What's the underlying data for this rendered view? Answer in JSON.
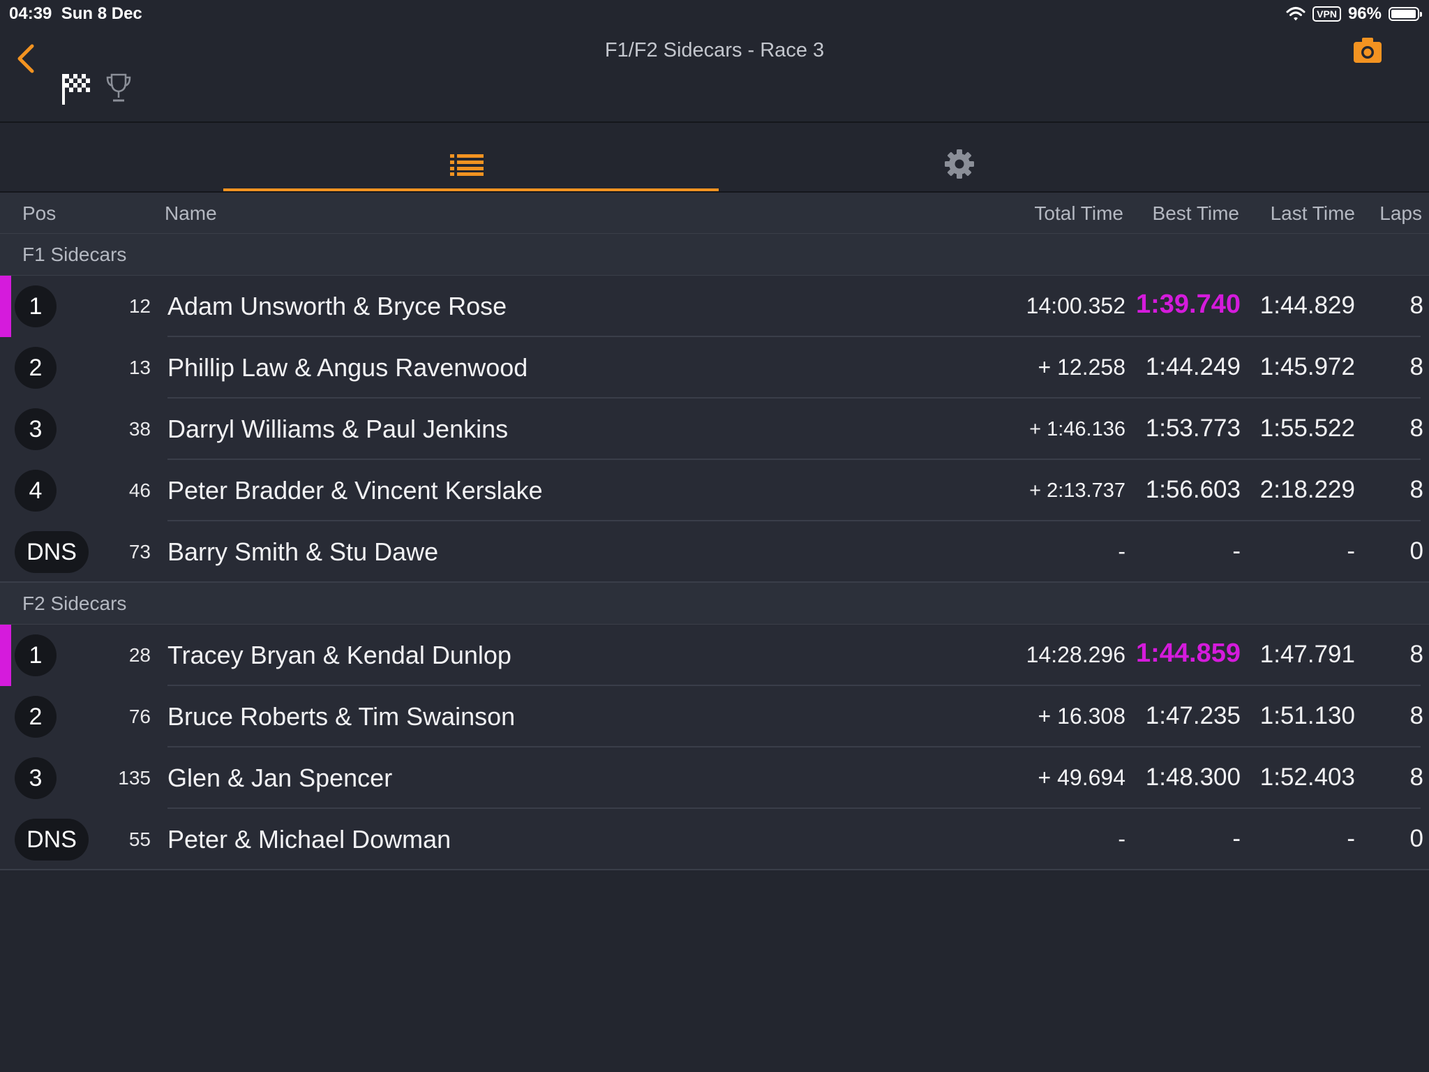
{
  "status": {
    "time": "04:39",
    "date": "Sun 8 Dec",
    "vpn": "VPN",
    "battery": "96%",
    "battery_level": 0.96
  },
  "header": {
    "title": "F1/F2 Sidecars - Race 3"
  },
  "icons": {
    "back": "chevron-left-icon",
    "camera": "camera-icon",
    "flag": "checkered-flag-icon",
    "trophy": "trophy-icon",
    "list": "list-icon",
    "settings": "gear-icon"
  },
  "colors": {
    "accent": "#f39321",
    "fastest": "#d51bdc",
    "background": "#23262f"
  },
  "columns": {
    "pos": "Pos",
    "name": "Name",
    "total": "Total Time",
    "best": "Best Time",
    "last": "Last Time",
    "laps": "Laps"
  },
  "groups": [
    {
      "name": "F1 Sidecars"
    },
    {
      "name": "F2 Sidecars"
    }
  ],
  "rows": [
    {
      "pos": "1",
      "num": "12",
      "name": "Adam Unsworth & Bryce Rose",
      "total": "14:00.352",
      "best": "1:39.740",
      "last": "1:44.829",
      "laps": "8",
      "fastest": true
    },
    {
      "pos": "2",
      "num": "13",
      "name": "Phillip Law & Angus Ravenwood",
      "total": "+ 12.258",
      "best": "1:44.249",
      "last": "1:45.972",
      "laps": "8"
    },
    {
      "pos": "3",
      "num": "38",
      "name": "Darryl Williams & Paul Jenkins",
      "total": "+ 1:46.136",
      "best": "1:53.773",
      "last": "1:55.522",
      "laps": "8"
    },
    {
      "pos": "4",
      "num": "46",
      "name": "Peter Bradder & Vincent Kerslake",
      "total": "+ 2:13.737",
      "best": "1:56.603",
      "last": "2:18.229",
      "laps": "8"
    },
    {
      "pos": "DNS",
      "num": "73",
      "name": "Barry Smith & Stu Dawe",
      "total": "-",
      "best": "-",
      "last": "-",
      "laps": "0"
    },
    {
      "pos": "1",
      "num": "28",
      "name": "Tracey Bryan & Kendal Dunlop",
      "total": "14:28.296",
      "best": "1:44.859",
      "last": "1:47.791",
      "laps": "8",
      "fastest": true
    },
    {
      "pos": "2",
      "num": "76",
      "name": "Bruce Roberts & Tim Swainson",
      "total": "+ 16.308",
      "best": "1:47.235",
      "last": "1:51.130",
      "laps": "8"
    },
    {
      "pos": "3",
      "num": "135",
      "name": "Glen & Jan Spencer",
      "total": "+ 49.694",
      "best": "1:48.300",
      "last": "1:52.403",
      "laps": "8"
    },
    {
      "pos": "DNS",
      "num": "55",
      "name": "Peter & Michael Dowman",
      "total": "-",
      "best": "-",
      "last": "-",
      "laps": "0"
    }
  ]
}
